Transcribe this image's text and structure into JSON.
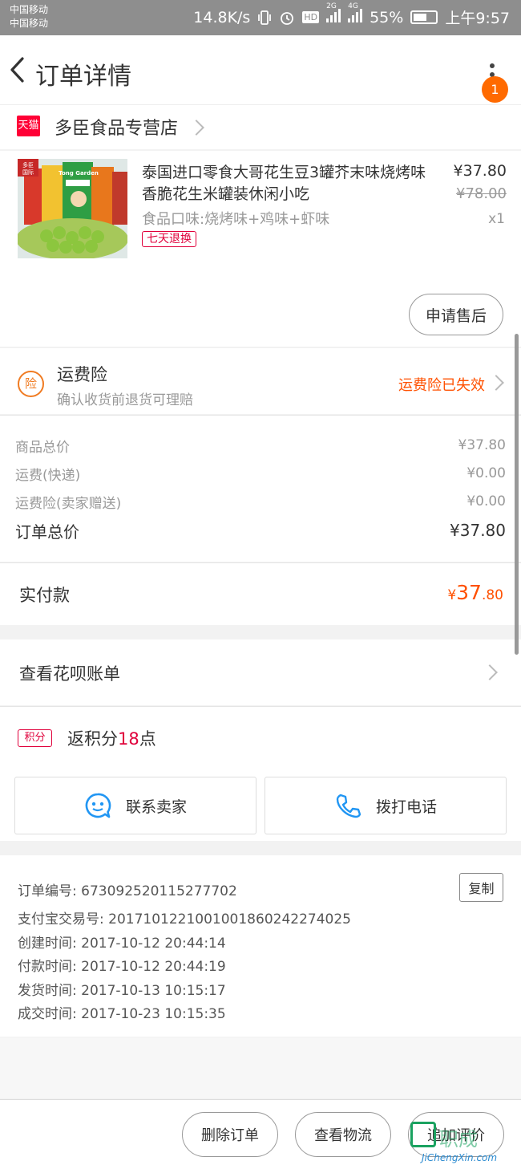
{
  "status_bar": {
    "carrier_1": "中国移动",
    "carrier_2": "中国移动",
    "net_speed": "14.8K/s",
    "hd": "HD",
    "net_2g": "2G",
    "net_4g": "4G",
    "battery": "55%",
    "time": "上午9:57"
  },
  "header": {
    "title": "订单详情",
    "notification_count": "1"
  },
  "shop": {
    "platform_tag": "天猫",
    "name": "多臣食品专营店"
  },
  "product": {
    "title": "泰国进口零食大哥花生豆3罐芥末味烧烤味香脆花生米罐装休闲小吃",
    "spec": "食品口味:烧烤味+鸡味+虾味",
    "return_tag": "七天退换",
    "price": "¥37.80",
    "original_price": "¥78.00",
    "quantity": "x1",
    "aftersale_button": "申请售后",
    "thumb_badge_1": "多臣",
    "thumb_badge_2": "国际",
    "thumb_brand": "Tong Garden"
  },
  "insurance": {
    "icon_label": "险",
    "title": "运费险",
    "subtitle": "确认收货前退货可理赔",
    "status": "运费险已失效"
  },
  "summary": {
    "rows": [
      {
        "label": "商品总价",
        "value": "¥37.80"
      },
      {
        "label": "运费(快递)",
        "value": "¥0.00"
      },
      {
        "label": "运费险(卖家赠送)",
        "value": "¥0.00"
      }
    ],
    "total_label": "订单总价",
    "total_value": "¥37.80"
  },
  "payment": {
    "label": "实付款",
    "currency": "¥",
    "amount_int": "37",
    "amount_dec": ".80"
  },
  "huabei": {
    "label": "查看花呗账单"
  },
  "points": {
    "tag": "积分",
    "prefix": "返积分",
    "count": "18",
    "suffix": "点"
  },
  "contact": {
    "seller": "联系卖家",
    "phone": "拨打电话"
  },
  "order_info": {
    "copy_button": "复制",
    "lines": [
      "订单编号: 673092520115277702",
      "支付宝交易号: 2017101221001001860242274025",
      "创建时间: 2017-10-12 20:44:14",
      "付款时间: 2017-10-12 20:44:19",
      "发货时间: 2017-10-13 10:15:17",
      "成交时间: 2017-10-23 10:15:35"
    ]
  },
  "bottom_bar": {
    "delete": "删除订单",
    "logistics": "查看物流",
    "review": "追加评价"
  },
  "watermark": {
    "text": "职成",
    "url": "JiChengXin.com"
  },
  "colors": {
    "accent_orange": "#ff5000",
    "tmall_red": "#ff0036",
    "contact_blue": "#2196f3"
  }
}
